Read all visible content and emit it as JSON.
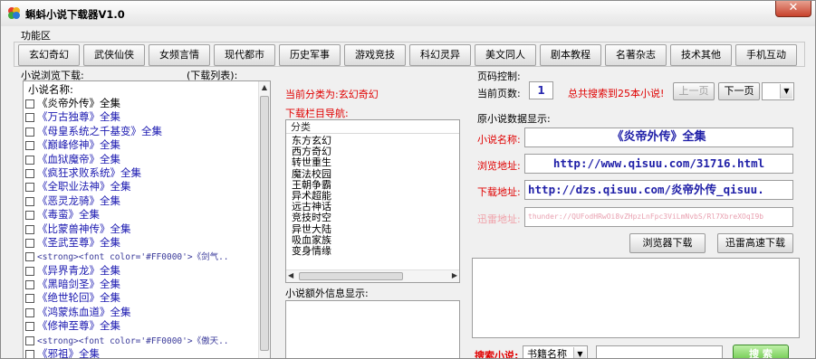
{
  "window": {
    "title": "蝌蚪小说下载器V1.0",
    "close_label": "✕"
  },
  "func_area_label": "功能区",
  "categories": [
    "玄幻奇幻",
    "武侠仙侠",
    "女频言情",
    "现代都市",
    "历史军事",
    "游戏竞技",
    "科幻灵异",
    "美文同人",
    "剧本教程",
    "名著杂志",
    "技术其他",
    "手机互动"
  ],
  "left_panel": {
    "browse_label": "小说浏览下载:",
    "download_list_label": "(下载列表):",
    "list_header": "小说名称:",
    "novels": [
      "《炎帝外传》全集",
      "《万古独尊》全集",
      "《母皇系统之千基变》全集",
      "《巅峰修神》全集",
      "《血狱魔帝》全集",
      "《疯狂求败系统》全集",
      "《全职业法神》全集",
      "《恶灵龙骑》全集",
      "《毒蛮》全集",
      "《比蒙兽神传》全集",
      "《圣武至尊》全集",
      "<strong><font color='#FF0000'>《剑气..",
      "《异界青龙》全集",
      "《黑暗剑圣》全集",
      "《绝世轮回》全集",
      "《鸿蒙炼血道》全集",
      "《修神至尊》全集",
      "<strong><font color='#FF0000'>《傲天..",
      "《邪祖》全集"
    ]
  },
  "middle_panel": {
    "current_category": "当前分类为:玄幻奇幻",
    "download_nav_label": "下载栏目导航:",
    "category_header": "分类",
    "sub_categories": [
      "东方玄幻",
      "西方奇幻",
      "转世重生",
      "魔法校园",
      "王朝争霸",
      "异术超能",
      "远古神话",
      "竞技时空",
      "异世大陆",
      "吸血家族",
      "变身情缘"
    ],
    "extra_info_label": "小说额外信息显示:"
  },
  "right_panel": {
    "page_control_label": "页码控制:",
    "current_page_label": "当前页数:",
    "current_page": "1",
    "total_info": "总共搜索到25本小说!",
    "prev_label": "上一页",
    "next_label": "下一页",
    "data_display_label": "原小说数据显示:",
    "name_label": "小说名称:",
    "name_value": "《炎帝外传》全集",
    "browse_label": "浏览地址:",
    "browse_value": "http://www.qisuu.com/31716.html",
    "download_label": "下载地址:",
    "download_value": "http://dzs.qisuu.com/炎帝外传_qisuu.",
    "thunder_label": "迅雷地址:",
    "thunder_value": "thunder://QUFodHRwOi8vZHpzLnFpc3ViLmNvbS/Rl7XbreXOqI9b",
    "browser_download_label": "浏览器下载",
    "thunder_download_label": "迅雷高速下载",
    "search_label": "搜索小说:",
    "search_type": "书籍名称",
    "search_button_label": "搜 索"
  }
}
